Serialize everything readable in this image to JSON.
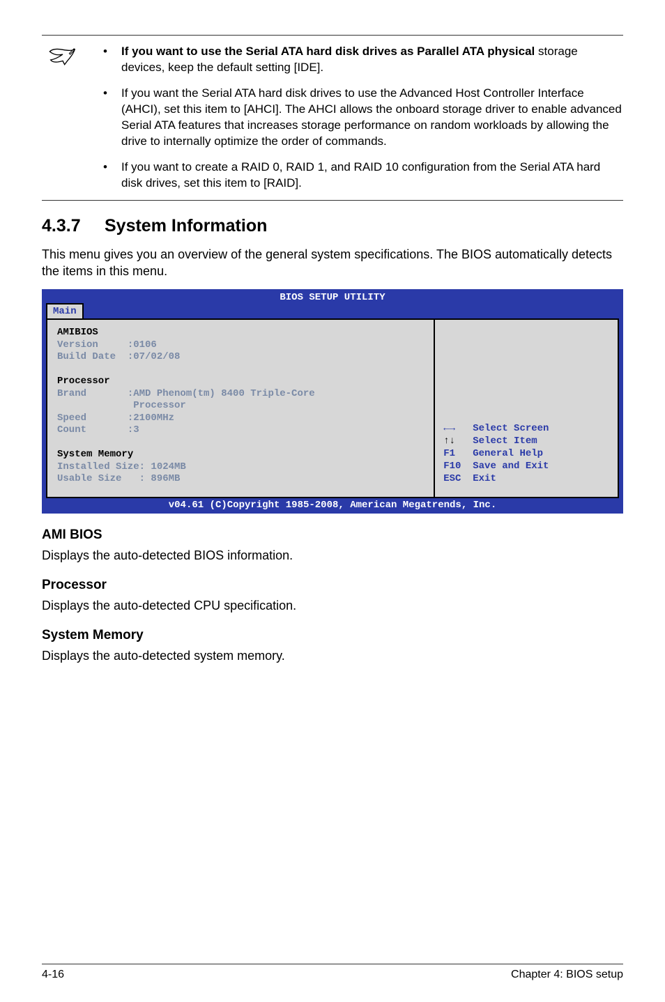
{
  "notes": [
    {
      "bold_lead": "If you want to use the Serial ATA hard disk drives as Parallel ATA physical",
      "rest": " storage devices, keep the default setting [IDE]."
    },
    {
      "text": "If you want the Serial ATA hard disk drives to use the Advanced Host Controller Interface (AHCI), set this item to [AHCI]. The AHCI allows the onboard storage driver to enable advanced Serial ATA features that increases storage performance on random workloads by allowing the drive to internally optimize the order of commands."
    },
    {
      "text": "If you want to create a RAID 0, RAID 1, and RAID 10 configuration from the Serial ATA hard disk drives, set this item to [RAID]."
    }
  ],
  "section": {
    "num": "4.3.7",
    "title": "System Information"
  },
  "intro": "This menu gives you an overview of the general system specifications. The BIOS automatically detects the items in this menu.",
  "bios": {
    "header": "BIOS SETUP UTILITY",
    "tab": "Main",
    "left_lines": [
      {
        "t": "AMIBIOS",
        "strong": true
      },
      {
        "t": "Version     :0106"
      },
      {
        "t": "Build Date  :07/02/08"
      },
      {
        "t": " "
      },
      {
        "t": "Processor",
        "strong": true
      },
      {
        "t": "Brand       :AMD Phenom(tm) 8400 Triple-Core"
      },
      {
        "t": "             Processor"
      },
      {
        "t": "Speed       :2100MHz"
      },
      {
        "t": "Count       :3"
      },
      {
        "t": " "
      },
      {
        "t": "System Memory",
        "strong": true
      },
      {
        "t": "Installed Size: 1024MB"
      },
      {
        "t": "Usable Size   : 896MB"
      }
    ],
    "right_help": [
      {
        "k": "←→",
        "v": "Select Screen",
        "kc": "blue"
      },
      {
        "k": "↑↓",
        "v": "Select Item",
        "kc": "black"
      },
      {
        "k": "F1",
        "v": "General Help",
        "kc": "blue"
      },
      {
        "k": "F10",
        "v": "Save and Exit",
        "kc": "blue"
      },
      {
        "k": "ESC",
        "v": "Exit",
        "kc": "blue"
      }
    ],
    "footer": "v04.61 (C)Copyright 1985-2008, American Megatrends, Inc."
  },
  "subs": [
    {
      "h": "AMI BIOS",
      "p": "Displays the auto-detected BIOS information."
    },
    {
      "h": "Processor",
      "p": "Displays the auto-detected CPU specification."
    },
    {
      "h": "System Memory",
      "p": "Displays the auto-detected system memory."
    }
  ],
  "footer": {
    "left": "4-16",
    "right": "Chapter 4: BIOS setup"
  }
}
